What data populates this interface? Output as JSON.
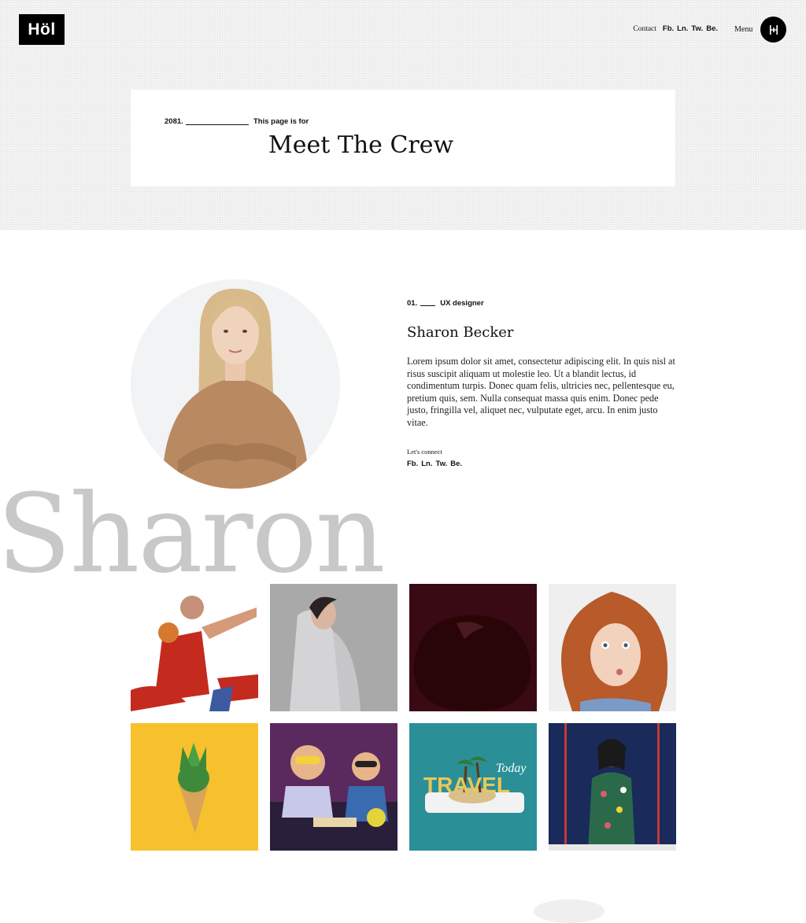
{
  "header": {
    "logo_text": "Höl",
    "contact_label": "Contact",
    "social": [
      "Fb.",
      "Ln.",
      "Tw.",
      "Be."
    ],
    "menu_label": "Menu"
  },
  "hero": {
    "kicker_number": "2081.",
    "kicker_label": "This page is for",
    "title": "Meet The Crew"
  },
  "member": {
    "number": "01.",
    "role": "UX designer",
    "name": "Sharon Becker",
    "bio": "Lorem ipsum dolor sit amet, consectetur adipiscing elit. In quis nisl at risus suscipit aliquam ut molestie leo. Ut a blandit lectus, id condimentum turpis. Donec quam felis, ultricies nec, pellentesque eu, pretium quis, sem. Nulla consequat massa quis enim. Donec pede justo, fringilla vel, aliquet nec, vulputate eget, arcu. In enim justo vitae.",
    "connect_label": "Let's connect",
    "social": [
      "Fb.",
      "Ln.",
      "Tw.",
      "Be."
    ],
    "watermark_name": "Sharon"
  },
  "gallery": [
    {
      "subject": "basketball player",
      "bg": "#ffffff"
    },
    {
      "subject": "woman in grey hoodie",
      "bg": "#a9a9a9"
    },
    {
      "subject": "dark fruit",
      "bg": "#3a0a14"
    },
    {
      "subject": "curly red hair girl",
      "bg": "#efefef"
    },
    {
      "subject": "pineapple ice cream cone",
      "bg": "#f7c12d"
    },
    {
      "subject": "kids with glasses science",
      "bg": "#5a2a5e"
    },
    {
      "subject": "travel phone island",
      "bg": "#2b8f98",
      "overlay_text": "TRAVEL",
      "overlay_script": "Today"
    },
    {
      "subject": "woman on stage",
      "bg": "#1a2a5a"
    }
  ],
  "colors": {
    "accent": "#000000",
    "watermark": "#c8c8c8"
  }
}
